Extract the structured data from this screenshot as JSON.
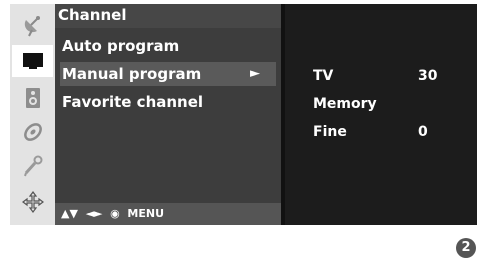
{
  "sidebar": {
    "icons": [
      "satellite-dish-icon",
      "screen-icon",
      "speaker-icon",
      "disc-icon",
      "remote-wand-icon",
      "settings-cross-icon"
    ],
    "active_index": 1
  },
  "menu": {
    "title": "Channel",
    "items": [
      {
        "label": "Auto program",
        "selected": false
      },
      {
        "label": "Manual program",
        "selected": true,
        "arrow": "►"
      },
      {
        "label": "Favorite channel",
        "selected": false
      }
    ],
    "hint": "▲▼  ◄►  ◉  MENU"
  },
  "panel": {
    "rows": [
      {
        "label": "TV",
        "value": "30"
      },
      {
        "label": "Memory",
        "value": ""
      },
      {
        "label": "Fine",
        "value": "0"
      }
    ]
  },
  "page_number": "2"
}
